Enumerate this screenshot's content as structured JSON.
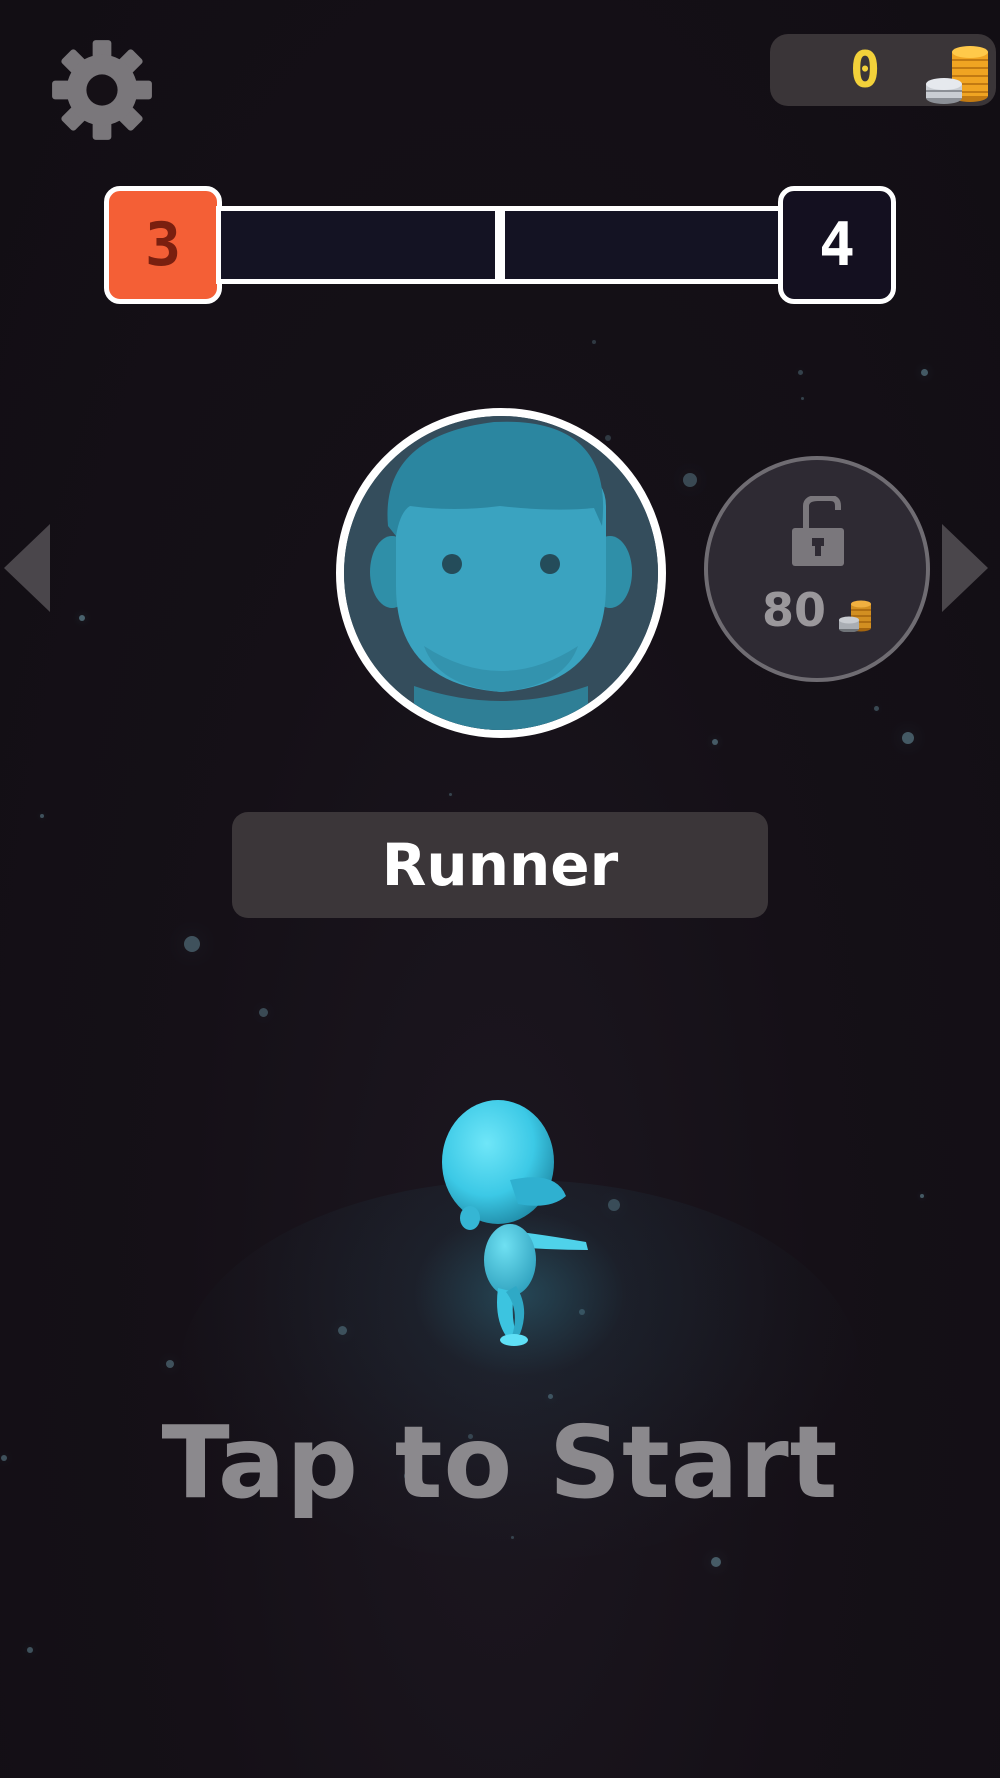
{
  "hud": {
    "settings_icon": "gear-icon",
    "coins": "0",
    "coin_icon": "coin-stack-icon"
  },
  "level": {
    "current": "3",
    "next": "4",
    "stage_progress": 0,
    "stage_segments": 2,
    "colors": {
      "current_fill": "#f45f36",
      "next_fill": "#141020",
      "track": "#141323"
    }
  },
  "character_select": {
    "left_arrow_icon": "triangle-left-icon",
    "right_arrow_icon": "triangle-right-icon",
    "selected_character_name": "Runner",
    "selected_portrait_icon": "face-icon",
    "locked_character": {
      "lock_icon": "padlock-icon",
      "price": "80",
      "price_icon": "coin-stack-icon"
    },
    "character_color": "#3fd2ec"
  },
  "prompt": {
    "start": "Tap to Start"
  }
}
